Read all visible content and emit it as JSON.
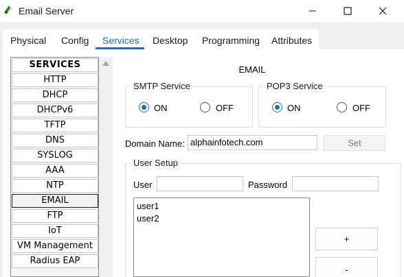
{
  "window": {
    "title": "Email Server"
  },
  "tabs": [
    {
      "label": "Physical"
    },
    {
      "label": "Config"
    },
    {
      "label": "Services"
    },
    {
      "label": "Desktop"
    },
    {
      "label": "Programming"
    },
    {
      "label": "Attributes"
    }
  ],
  "active_tab": "Services",
  "services": {
    "header": "SERVICES",
    "items": [
      "HTTP",
      "DHCP",
      "DHCPv6",
      "TFTP",
      "DNS",
      "SYSLOG",
      "AAA",
      "NTP",
      "EMAIL",
      "FTP",
      "IoT",
      "VM Management",
      "Radius EAP"
    ],
    "selected": "EMAIL"
  },
  "email": {
    "title": "EMAIL",
    "smtp": {
      "label": "SMTP Service",
      "on_label": "ON",
      "off_label": "OFF",
      "value": "ON"
    },
    "pop3": {
      "label": "POP3 Service",
      "on_label": "ON",
      "off_label": "OFF",
      "value": "ON"
    },
    "domain": {
      "label": "Domain Name:",
      "value": "alphainfotech.com",
      "set_label": "Set"
    },
    "user_setup": {
      "label": "User Setup",
      "user_label": "User",
      "user_value": "",
      "password_label": "Password",
      "password_value": "",
      "users": [
        "user1",
        "user2"
      ],
      "add_label": "+",
      "remove_label": "-"
    }
  },
  "colors": {
    "accent": "#1c6fb5"
  }
}
